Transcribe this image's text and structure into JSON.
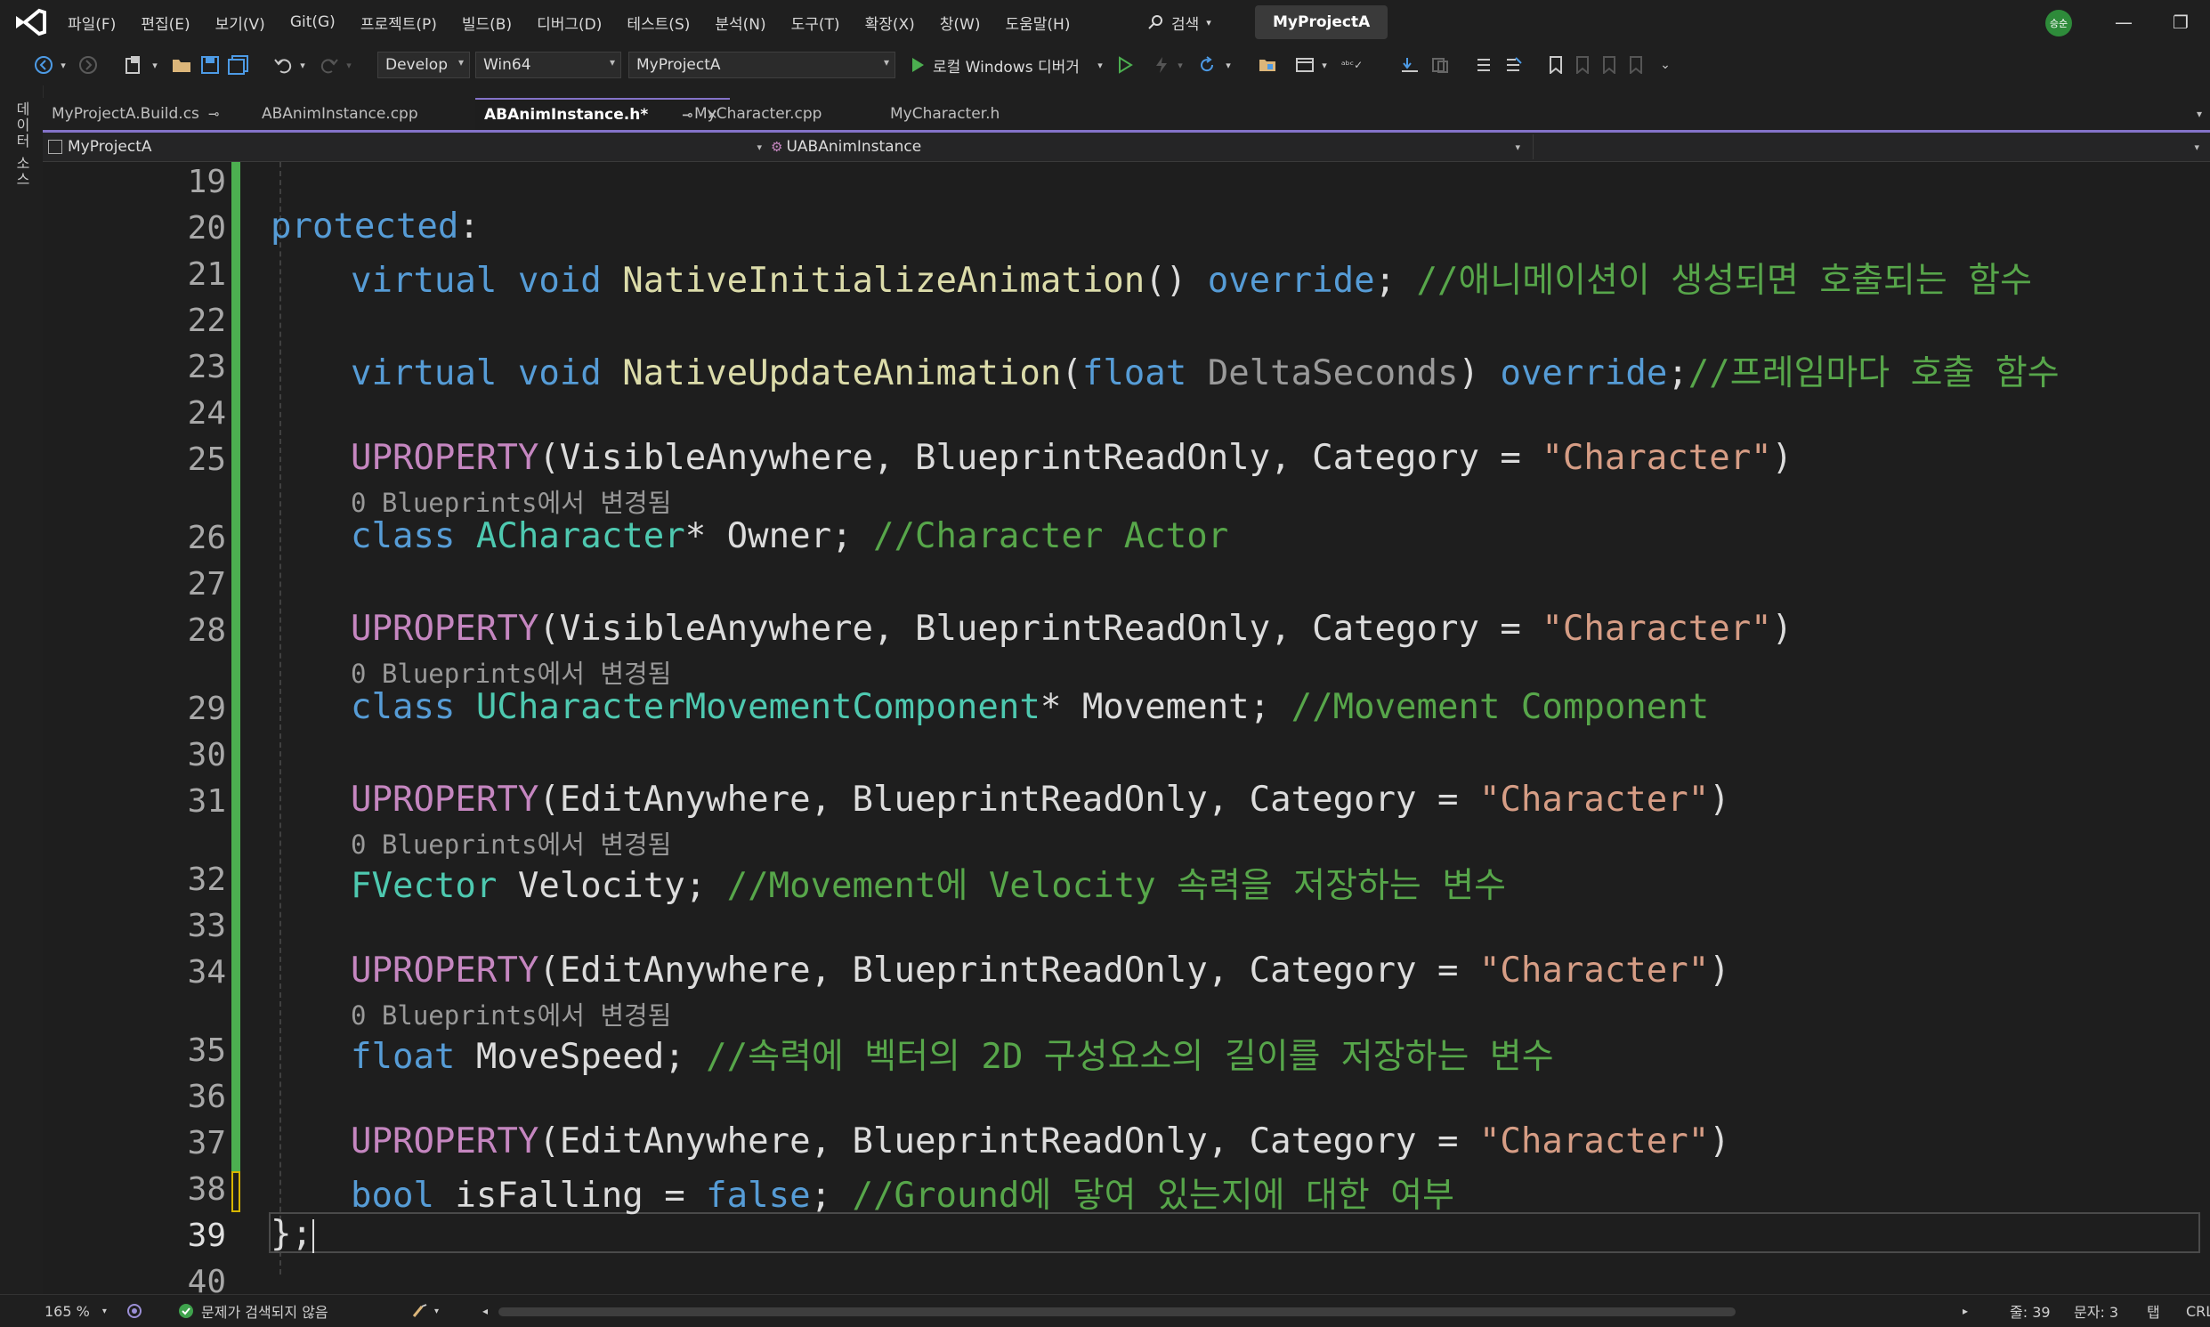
{
  "menu": [
    "파일(F)",
    "편집(E)",
    "보기(V)",
    "Git(G)",
    "프로젝트(P)",
    "빌드(B)",
    "디버그(D)",
    "테스트(S)",
    "분석(N)",
    "도구(T)",
    "확장(X)",
    "창(W)",
    "도움말(H)"
  ],
  "search_label": "검색",
  "project_badge": "MyProjectA",
  "avatar_initials": "승순",
  "toolbar": {
    "config": "Develop",
    "platform": "Win64",
    "startup_project": "MyProjectA",
    "run_label": "로컬 Windows 디버거"
  },
  "left_strip_label": "데이터 소스",
  "tabs": [
    {
      "label": "MyProjectA.Build.cs",
      "pinned": true
    },
    {
      "label": "ABAnimInstance.cpp"
    },
    {
      "label": "ABAnimInstance.h*",
      "active": true
    },
    {
      "label": "MyCharacter.cpp"
    },
    {
      "label": "MyCharacter.h"
    }
  ],
  "nav": {
    "project": "MyProjectA",
    "scope": "UABAnimInstance"
  },
  "line_numbers": [
    "19",
    "20",
    "21",
    "22",
    "23",
    "24",
    "25",
    "26",
    "27",
    "28",
    "29",
    "30",
    "31",
    "32",
    "33",
    "34",
    "35",
    "36",
    "37",
    "38",
    "39",
    "40"
  ],
  "current_line": "39",
  "code": {
    "l20_kw": "protected",
    "l20_p": ":",
    "l21_kw1": "virtual",
    "l21_kw2": "void",
    "l21_fn": "NativeInitializeAnimation",
    "l21_p": "()",
    "l21_kw3": "override",
    "l21_semi": ";",
    "l21_cm": "//애니메이션이 생성되면 호출되는 함수",
    "l23_kw1": "virtual",
    "l23_kw2": "void",
    "l23_fn": "NativeUpdateAnimation",
    "l23_p1": "(",
    "l23_kw3": "float",
    "l23_pm": "DeltaSeconds",
    "l23_p2": ")",
    "l23_kw4": "override",
    "l23_semi": ";",
    "l23_cm": "//프레임마다 호출 함수",
    "l25_mac": "UPROPERTY",
    "l25_args": "(VisibleAnywhere, BlueprintReadOnly, Category = ",
    "l25_str": "\"Character\"",
    "l25_end": ")",
    "lens1": "0 Blueprints에서 변경됨",
    "l26_kw": "class",
    "l26_ty": "ACharacter",
    "l26_rest": "* Owner; ",
    "l26_cm": "//Character Actor",
    "l28_mac": "UPROPERTY",
    "l28_args": "(VisibleAnywhere, BlueprintReadOnly, Category = ",
    "l28_str": "\"Character\"",
    "l28_end": ")",
    "lens2": "0 Blueprints에서 변경됨",
    "l29_kw": "class",
    "l29_ty": "UCharacterMovementComponent",
    "l29_rest": "* Movement; ",
    "l29_cm": "//Movement Component",
    "l31_mac": "UPROPERTY",
    "l31_args": "(EditAnywhere, BlueprintReadOnly, Category = ",
    "l31_str": "\"Character\"",
    "l31_end": ")",
    "lens3": "0 Blueprints에서 변경됨",
    "l32_ty": "FVector",
    "l32_rest": " Velocity; ",
    "l32_cm": "//Movement에 Velocity 속력을 저장하는 변수",
    "l34_mac": "UPROPERTY",
    "l34_args": "(EditAnywhere, BlueprintReadOnly, Category = ",
    "l34_str": "\"Character\"",
    "l34_end": ")",
    "lens4": "0 Blueprints에서 변경됨",
    "l35_kw": "float",
    "l35_rest": " MoveSpeed; ",
    "l35_cm": "//속력에 벡터의 2D 구성요소의 길이를 저장하는 변수",
    "l37_mac": "UPROPERTY",
    "l37_args": "(EditAnywhere, BlueprintReadOnly, Category = ",
    "l37_str": "\"Character\"",
    "l37_end": ")",
    "l38_kw": "bool",
    "l38_rest": " isFalling = ",
    "l38_kw2": "false",
    "l38_semi": "; ",
    "l38_cm": "//Ground에 닿여 있는지에 대한 여부",
    "l39": "};"
  },
  "status": {
    "zoom": "165 %",
    "issues": "문제가 검색되지 않음",
    "line": "줄: 39",
    "col": "문자: 3",
    "tab": "탭",
    "eol": "CRLF"
  },
  "colors": {
    "keyword": "#569cd6",
    "function": "#dcdcaa",
    "type": "#4ec9b0",
    "macro": "#c586c0",
    "string": "#d69d85",
    "comment": "#57a64a",
    "accent": "#8473c9"
  }
}
